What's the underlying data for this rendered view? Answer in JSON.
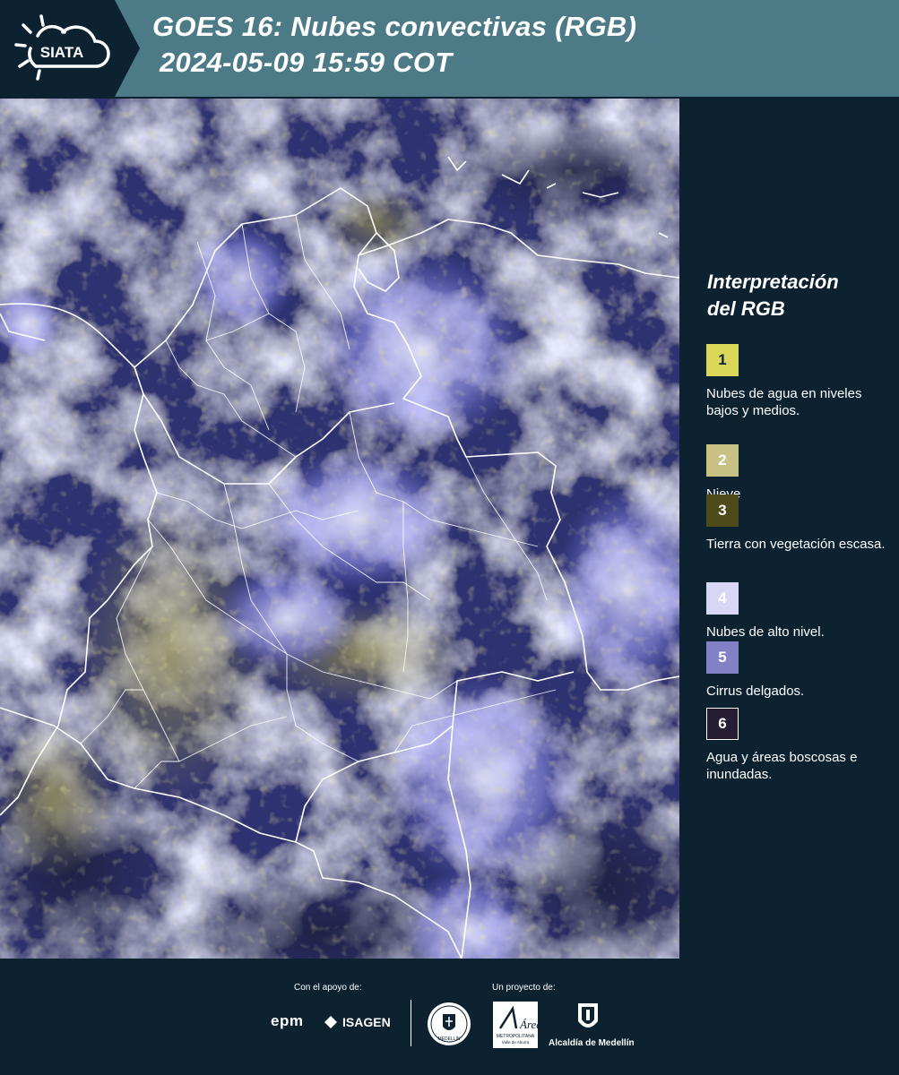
{
  "header": {
    "logo_text": "SIATA",
    "title_line1": "GOES 16: Nubes convectivas (RGB)",
    "title_line2": "2024-05-09 15:59 COT"
  },
  "legend": {
    "title_line1": "Interpretación",
    "title_line2": "del RGB",
    "items": [
      {
        "number": "1",
        "label": "Nubes de agua en niveles bajos y medios.",
        "color": "#d9d65a",
        "text_color": "#0c2230"
      },
      {
        "number": "2",
        "label": "Nieve",
        "color": "#c7c184",
        "text_color": "#ffffff"
      },
      {
        "number": "3",
        "label": "Tierra con vegetación escasa.",
        "color": "#4f4a1b",
        "text_color": "#ffffff"
      },
      {
        "number": "4",
        "label": "Nubes de alto nivel.",
        "color": "#d7d6f4",
        "text_color": "#ffffff"
      },
      {
        "number": "5",
        "label": "Cirrus delgados.",
        "color": "#8381c6",
        "text_color": "#ffffff"
      },
      {
        "number": "6",
        "label": "Agua y áreas boscosas e inundadas.",
        "color": "#261c33",
        "text_color": "#ffffff"
      }
    ]
  },
  "footer": {
    "support_caption": "Con el apoyo de:",
    "project_caption": "Un proyecto de:",
    "epm_logo": "epm",
    "isagen_logo": "ISAGEN",
    "area_logo_text": "Área",
    "area_logo_sub1": "METROPOLITANA",
    "area_logo_sub2": "Valle de Aburrá",
    "alcaldia_logo": "Alcaldía de Medellín",
    "seal_text": "MEDELLÍN"
  },
  "map": {
    "region": "Colombia",
    "layers": [
      "satellite-rgb-imagery",
      "country-borders",
      "department-borders"
    ]
  }
}
